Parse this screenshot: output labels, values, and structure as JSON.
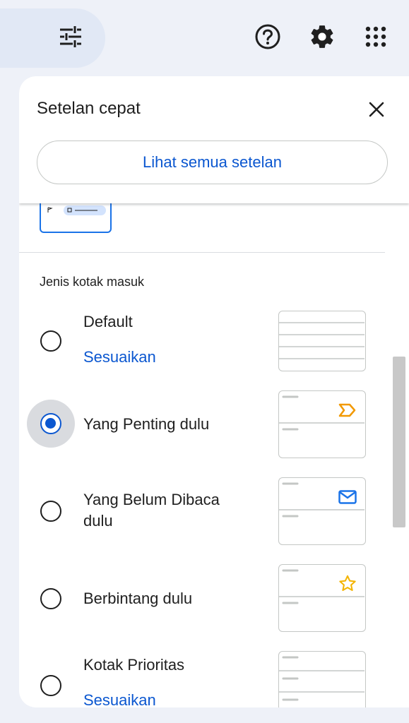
{
  "header": {
    "tune_icon": "tune-icon",
    "help_icon": "help-icon",
    "settings_icon": "settings-gear-icon",
    "apps_icon": "apps-grid-icon"
  },
  "quick_settings": {
    "title": "Setelan cepat",
    "see_all_label": "Lihat semua setelan",
    "close_icon": "close-icon"
  },
  "inbox_type": {
    "section_label": "Jenis kotak masuk",
    "options": [
      {
        "label": "Default",
        "link": "Sesuaikan",
        "selected": false,
        "preview_icon": ""
      },
      {
        "label": "Yang Penting dulu",
        "link": "",
        "selected": true,
        "preview_icon": "important-marker-icon"
      },
      {
        "label": "Yang Belum Dibaca dulu",
        "link": "",
        "selected": false,
        "preview_icon": "mail-icon"
      },
      {
        "label": "Berbintang dulu",
        "link": "",
        "selected": false,
        "preview_icon": "star-icon"
      },
      {
        "label": "Kotak Prioritas",
        "link": "Sesuaikan",
        "selected": false,
        "preview_icon": ""
      }
    ]
  },
  "colors": {
    "accent": "#0b57d0",
    "important": "#f29900",
    "star": "#f4b400",
    "mail": "#1a73e8",
    "background": "#eef1f8"
  }
}
